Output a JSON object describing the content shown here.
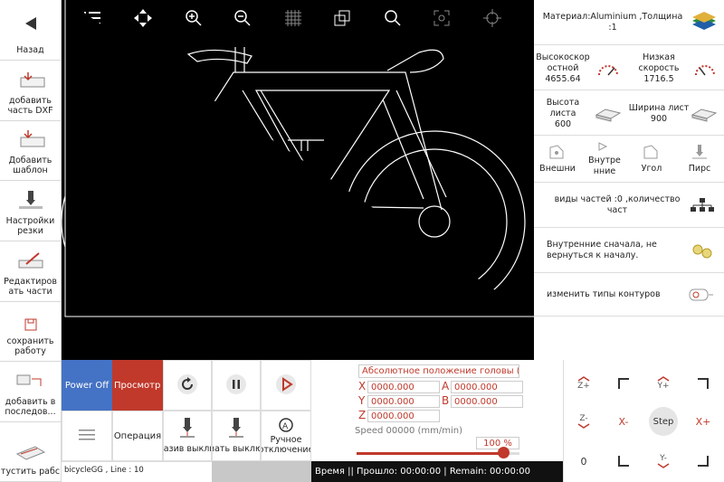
{
  "sidebar": {
    "items": [
      {
        "label": "Назад",
        "icon": "back-arrow-icon"
      },
      {
        "label": "добавить часть DXF",
        "icon": "add-dxf-icon"
      },
      {
        "label": "Добавить шаблон",
        "icon": "add-template-icon"
      },
      {
        "label": "Настройки резки",
        "icon": "cut-settings-icon"
      },
      {
        "label": "Редактиров ать части",
        "icon": "edit-parts-icon"
      },
      {
        "label": "сохранить работу",
        "icon": "save-icon"
      },
      {
        "label": "добавить в последов...",
        "icon": "add-sequence-icon"
      },
      {
        "label": "тустить рабс",
        "icon": "run-job-icon"
      }
    ]
  },
  "toolbar": {
    "icons": [
      "list-icon",
      "move-arrows-icon",
      "zoom-in-icon",
      "zoom-out-icon",
      "grid-icon",
      "fit-window-icon",
      "search-icon",
      "fullscreen-icon",
      "target-icon"
    ]
  },
  "right_panel": {
    "material": "Материал:Aluminium ,Толщина :1",
    "high_speed_label": "Высокоскор остной",
    "high_speed_value": "4655.64",
    "low_speed_label": "Низкая скорость",
    "low_speed_value": "1716.5",
    "sheet_height_label": "Высота листа",
    "sheet_height_value": "600",
    "sheet_width_label": "Ширина лист",
    "sheet_width_value": "900",
    "tabs": [
      "Внешни",
      "Внутре нние",
      "Угол",
      "Пирс"
    ],
    "parts_info": "виды частей :0 ,количество част",
    "inner_first": "Внутренние сначала, не вернуться к началу.",
    "change_contours": "изменить типы контуров"
  },
  "control": {
    "power_off": "Power Off",
    "preview": "Просмотр со",
    "operation": "Операция",
    "laser_off1": "разив выклю",
    "laser_off2": "зать выклю",
    "manual_off": "Ручное отключение"
  },
  "coords": {
    "header": "Абсолютное положение головы (mr",
    "x": "0000.000",
    "y": "0000.000",
    "z": "0000.000",
    "a": "0000.000",
    "b": "0000.000",
    "speed_label": "Speed 00000 (mm/min)",
    "speed_percent": "100 %",
    "speed_fraction": 1.0
  },
  "jog": {
    "z_plus": "Z+",
    "y_plus": "Y+",
    "z_minus": "Z-",
    "x_minus": "X-",
    "step": "Step",
    "x_plus": "X+",
    "y_minus": "Y-",
    "zero": "0"
  },
  "status": {
    "file": "bicycleGG , Line : 10",
    "time": "Время || Прошло: 00:00:00 | Remain: 00:00:00"
  },
  "colors": {
    "power_off": "#4472c4",
    "preview": "#c0392b",
    "accent_red": "#c0392b"
  }
}
